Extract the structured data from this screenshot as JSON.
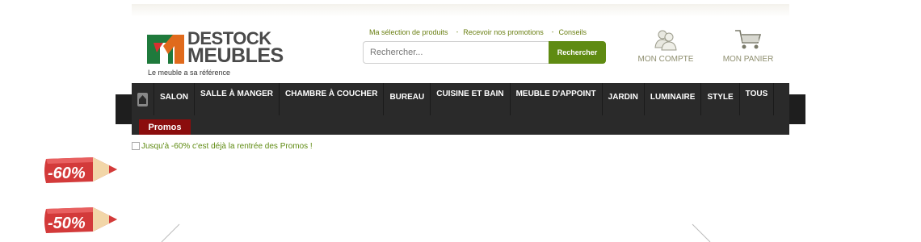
{
  "logo": {
    "line1": "DESTOCK",
    "line2": "MEUBLES",
    "tagline": "Le meuble a sa référence"
  },
  "top_links": [
    "Ma sélection de produits",
    "Recevoir nos promotions",
    "Conseils"
  ],
  "search": {
    "placeholder": "Rechercher...",
    "button": "Rechercher"
  },
  "account": {
    "label": "MON COMPTE",
    "icon": "users-icon"
  },
  "cart": {
    "label": "MON PANIER",
    "icon": "cart-icon"
  },
  "nav": {
    "home_icon": "home-icon",
    "items": [
      "SALON",
      "SALLE À MANGER",
      "CHAMBRE À COUCHER",
      "BUREAU",
      "CUISINE ET BAIN",
      "MEUBLE D'APPOINT",
      "JARDIN",
      "LUMINAIRE",
      "STYLE",
      "TOUS"
    ],
    "promos": "Promos"
  },
  "banner": {
    "alt_text": "Jusqu'à -60% c'est déjà la rentrée des Promos !"
  },
  "promo_tags": [
    "-60%",
    "-50%"
  ],
  "colors": {
    "accent_green": "#5f8b12",
    "nav_bg": "#2a2a2a",
    "promo_red": "#8b0d0d",
    "tag_red": "#d33a3a"
  }
}
